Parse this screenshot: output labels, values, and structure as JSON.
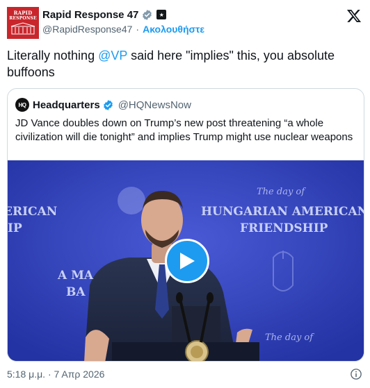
{
  "author": {
    "display_name": "Rapid Response 47",
    "handle": "@RapidResponse47",
    "separator": "·",
    "follow_label": "Ακολουθήστε",
    "avatar_text_line1": "RAPID",
    "avatar_text_line2": "RESPONSE"
  },
  "tweet": {
    "text_before": "Literally nothing ",
    "mention": "@VP",
    "text_after": " said here \"implies\" this, you absolute buffoons"
  },
  "quote": {
    "avatar_text": "HQ",
    "name": "Headquarters",
    "handle": "@HQNewsNow",
    "text": "JD Vance doubles down on Trump’s new post threatening “a whole civilization will die tonight” and implies Trump might use nuclear weapons",
    "media": {
      "banner_script": "The day of",
      "banner_line1": "HUNGARIAN AMERICAN",
      "banner_line2": "FRIENDSHIP",
      "banner_left1": "ERICAN",
      "banner_left2": "IP",
      "banner_left3": "A MA",
      "banner_left4": "BA",
      "banner_bottom": "The day of",
      "colors": {
        "backdrop": "#2f3fb4",
        "play_button": "#1d9bf0"
      }
    }
  },
  "footer": {
    "timestamp": "5:18 μ.μ. · 7 Απρ 2026"
  },
  "icons": [
    "verified-gray-icon",
    "affiliate-badge-icon",
    "x-logo-icon",
    "verified-blue-icon",
    "play-icon",
    "info-icon"
  ]
}
